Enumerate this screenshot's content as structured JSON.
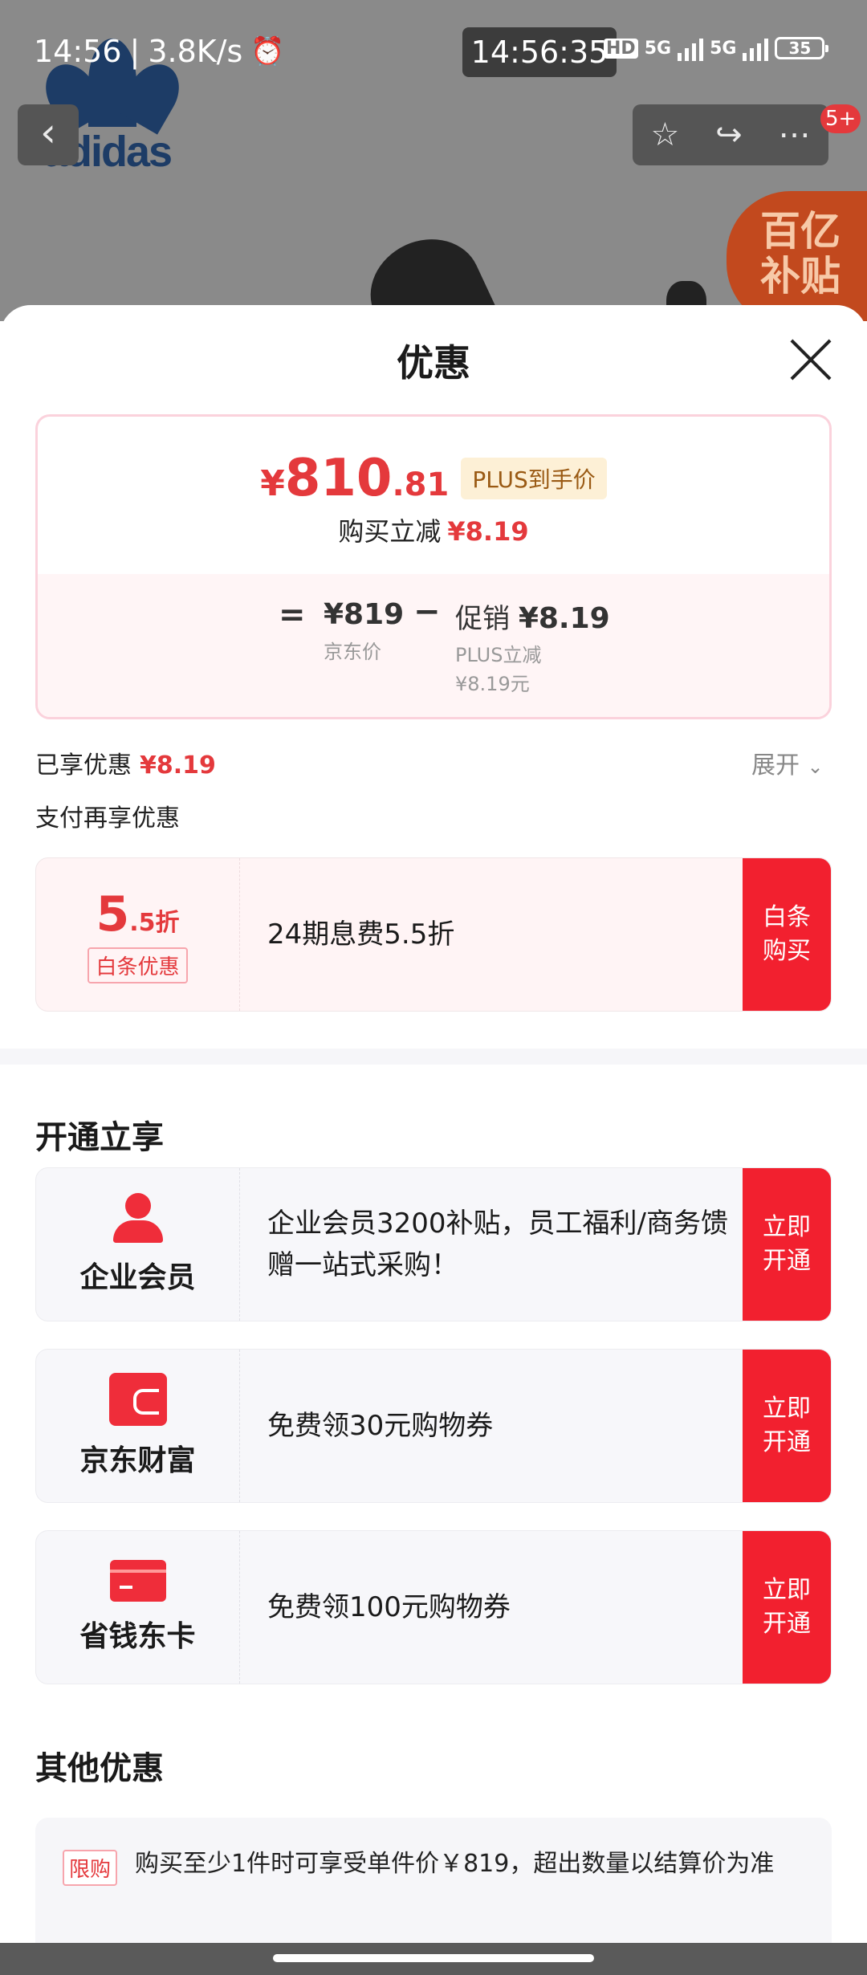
{
  "status_bar": {
    "time": "14:56",
    "net_speed": "3.8K/s",
    "clock_overlay": "14:56:35",
    "hd_label": "HD",
    "net1": "5G",
    "net2": "5G",
    "battery": "35"
  },
  "background": {
    "brand_word": "adidas",
    "subsidy_line1": "百亿",
    "subsidy_line2": "补贴",
    "cart_badge": "5+"
  },
  "sheet": {
    "title": "优惠",
    "final_price": {
      "currency": "¥",
      "integer": "810",
      "decimal": ".81"
    },
    "plus_tag": "PLUS到手价",
    "instant_cut_label": "购买立减",
    "instant_cut_value": "¥8.19",
    "equals": "=",
    "jd_price": "¥819",
    "jd_price_label": "京东价",
    "minus": "−",
    "promo_label": "促销",
    "promo_value": "¥8.19",
    "promo_sub1": "PLUS立减",
    "promo_sub2": "¥8.19元",
    "enjoyed_label": "已享优惠",
    "enjoyed_value": "¥8.19",
    "expand_label": "展开",
    "pay_more_label": "支付再享优惠",
    "baitiao": {
      "discount_int": "5",
      "discount_dec": ".5折",
      "tag": "白条优惠",
      "desc": "24期息费5.5折",
      "cta_line1": "白条",
      "cta_line2": "购买"
    },
    "open_section_title": "开通立享",
    "open_items": [
      {
        "name": "企业会员",
        "desc": "企业会员3200补贴，员工福利/商务馈赠一站式采购！",
        "cta_line1": "立即",
        "cta_line2": "开通"
      },
      {
        "name": "京东财富",
        "desc": "免费领30元购物券",
        "cta_line1": "立即",
        "cta_line2": "开通"
      },
      {
        "name": "省钱东卡",
        "desc": "免费领100元购物券",
        "cta_line1": "立即",
        "cta_line2": "开通"
      }
    ],
    "other_section_title": "其他优惠",
    "limit_tag": "限购",
    "limit_text": "购买至少1件时可享受单件价￥819，超出数量以结算价为准"
  },
  "colors": {
    "accent_red": "#e4393c",
    "cta_red": "#f2202f"
  }
}
